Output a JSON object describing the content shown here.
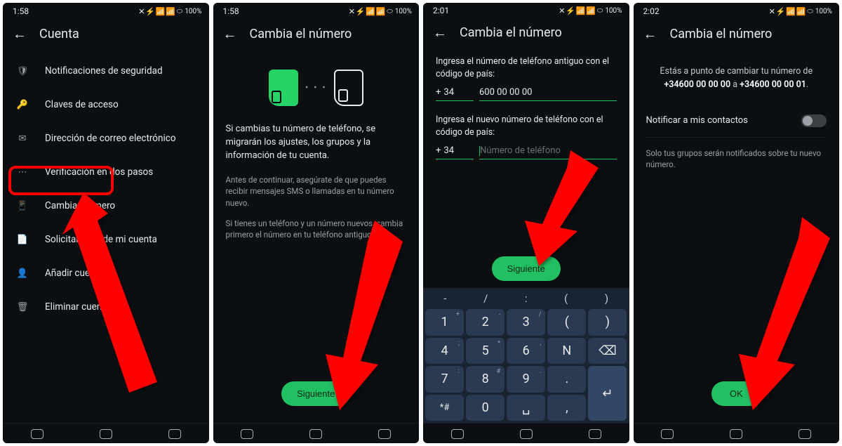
{
  "screens": {
    "s1": {
      "time": "1:58",
      "battery": "100%",
      "title": "Cuenta",
      "menu": [
        {
          "label": "Notificaciones de seguridad"
        },
        {
          "label": "Claves de acceso"
        },
        {
          "label": "Dirección de correo electrónico"
        },
        {
          "label": "Verificación en dos pasos"
        },
        {
          "label": "Cambiar número"
        },
        {
          "label": "Solicitar info. de mi cuenta"
        },
        {
          "label": "Añadir cuenta"
        },
        {
          "label": "Eliminar cuenta"
        }
      ]
    },
    "s2": {
      "time": "1:58",
      "battery": "100%",
      "title": "Cambia el número",
      "body": "Si cambias tu número de teléfono, se migrarán los ajustes, los grupos y la información de tu cuenta.",
      "hint1": "Antes de continuar, asegúrate de que puedes recibir mensajes SMS o llamadas en tu número nuevo.",
      "hint2": "Si tienes un teléfono y un número nuevos, cambia primero el número en tu teléfono antiguo.",
      "button": "Siguiente"
    },
    "s3": {
      "time": "2:01",
      "battery": "100%",
      "title": "Cambia el número",
      "label_old": "Ingresa el número de teléfono antiguo con el código de país:",
      "cc_old": "34",
      "num_old": "600 00 00 00",
      "label_new": "Ingresa el nuevo número de teléfono con el código de país:",
      "cc_new": "34",
      "placeholder_new": "Número de teléfono",
      "button": "Siguiente",
      "keypad_syms": [
        "-",
        "/",
        ":",
        "(",
        ")"
      ],
      "keys": [
        {
          "n": "1",
          "s": "+"
        },
        {
          "n": "2",
          "s": "-"
        },
        {
          "n": "3",
          "s": "/"
        },
        {
          "n": "(",
          "s": ""
        },
        {
          "n": ")",
          "s": ""
        },
        {
          "n": "4",
          "s": ";"
        },
        {
          "n": "5",
          "s": "*"
        },
        {
          "n": "6",
          "s": ","
        },
        {
          "n": "N",
          "s": ""
        },
        {
          "n": "⌫",
          "s": ""
        },
        {
          "n": "7",
          "s": ":"
        },
        {
          "n": "8",
          "s": "#"
        },
        {
          "n": "9",
          "s": "."
        },
        {
          "n": ".",
          "s": ""
        },
        {
          "n": "↵",
          "s": ""
        },
        {
          "n": "*#",
          "s": ""
        },
        {
          "n": "0",
          "s": ""
        },
        {
          "n": "␣",
          "s": ""
        },
        {
          "n": ",",
          "s": ""
        },
        {
          "n": "",
          "s": ""
        }
      ]
    },
    "s4": {
      "time": "2:02",
      "battery": "100%",
      "title": "Cambia el número",
      "confirm_pre": "Estás a punto de cambiar tu número de ",
      "old_num": "+34600 00 00 00",
      "confirm_mid": " a ",
      "new_num": "+34600 00 00 01",
      "confirm_post": ".",
      "toggle_label": "Notificar a mis contactos",
      "note": "Solo tus grupos serán notificados sobre tu nuevo número.",
      "button": "OK"
    }
  }
}
